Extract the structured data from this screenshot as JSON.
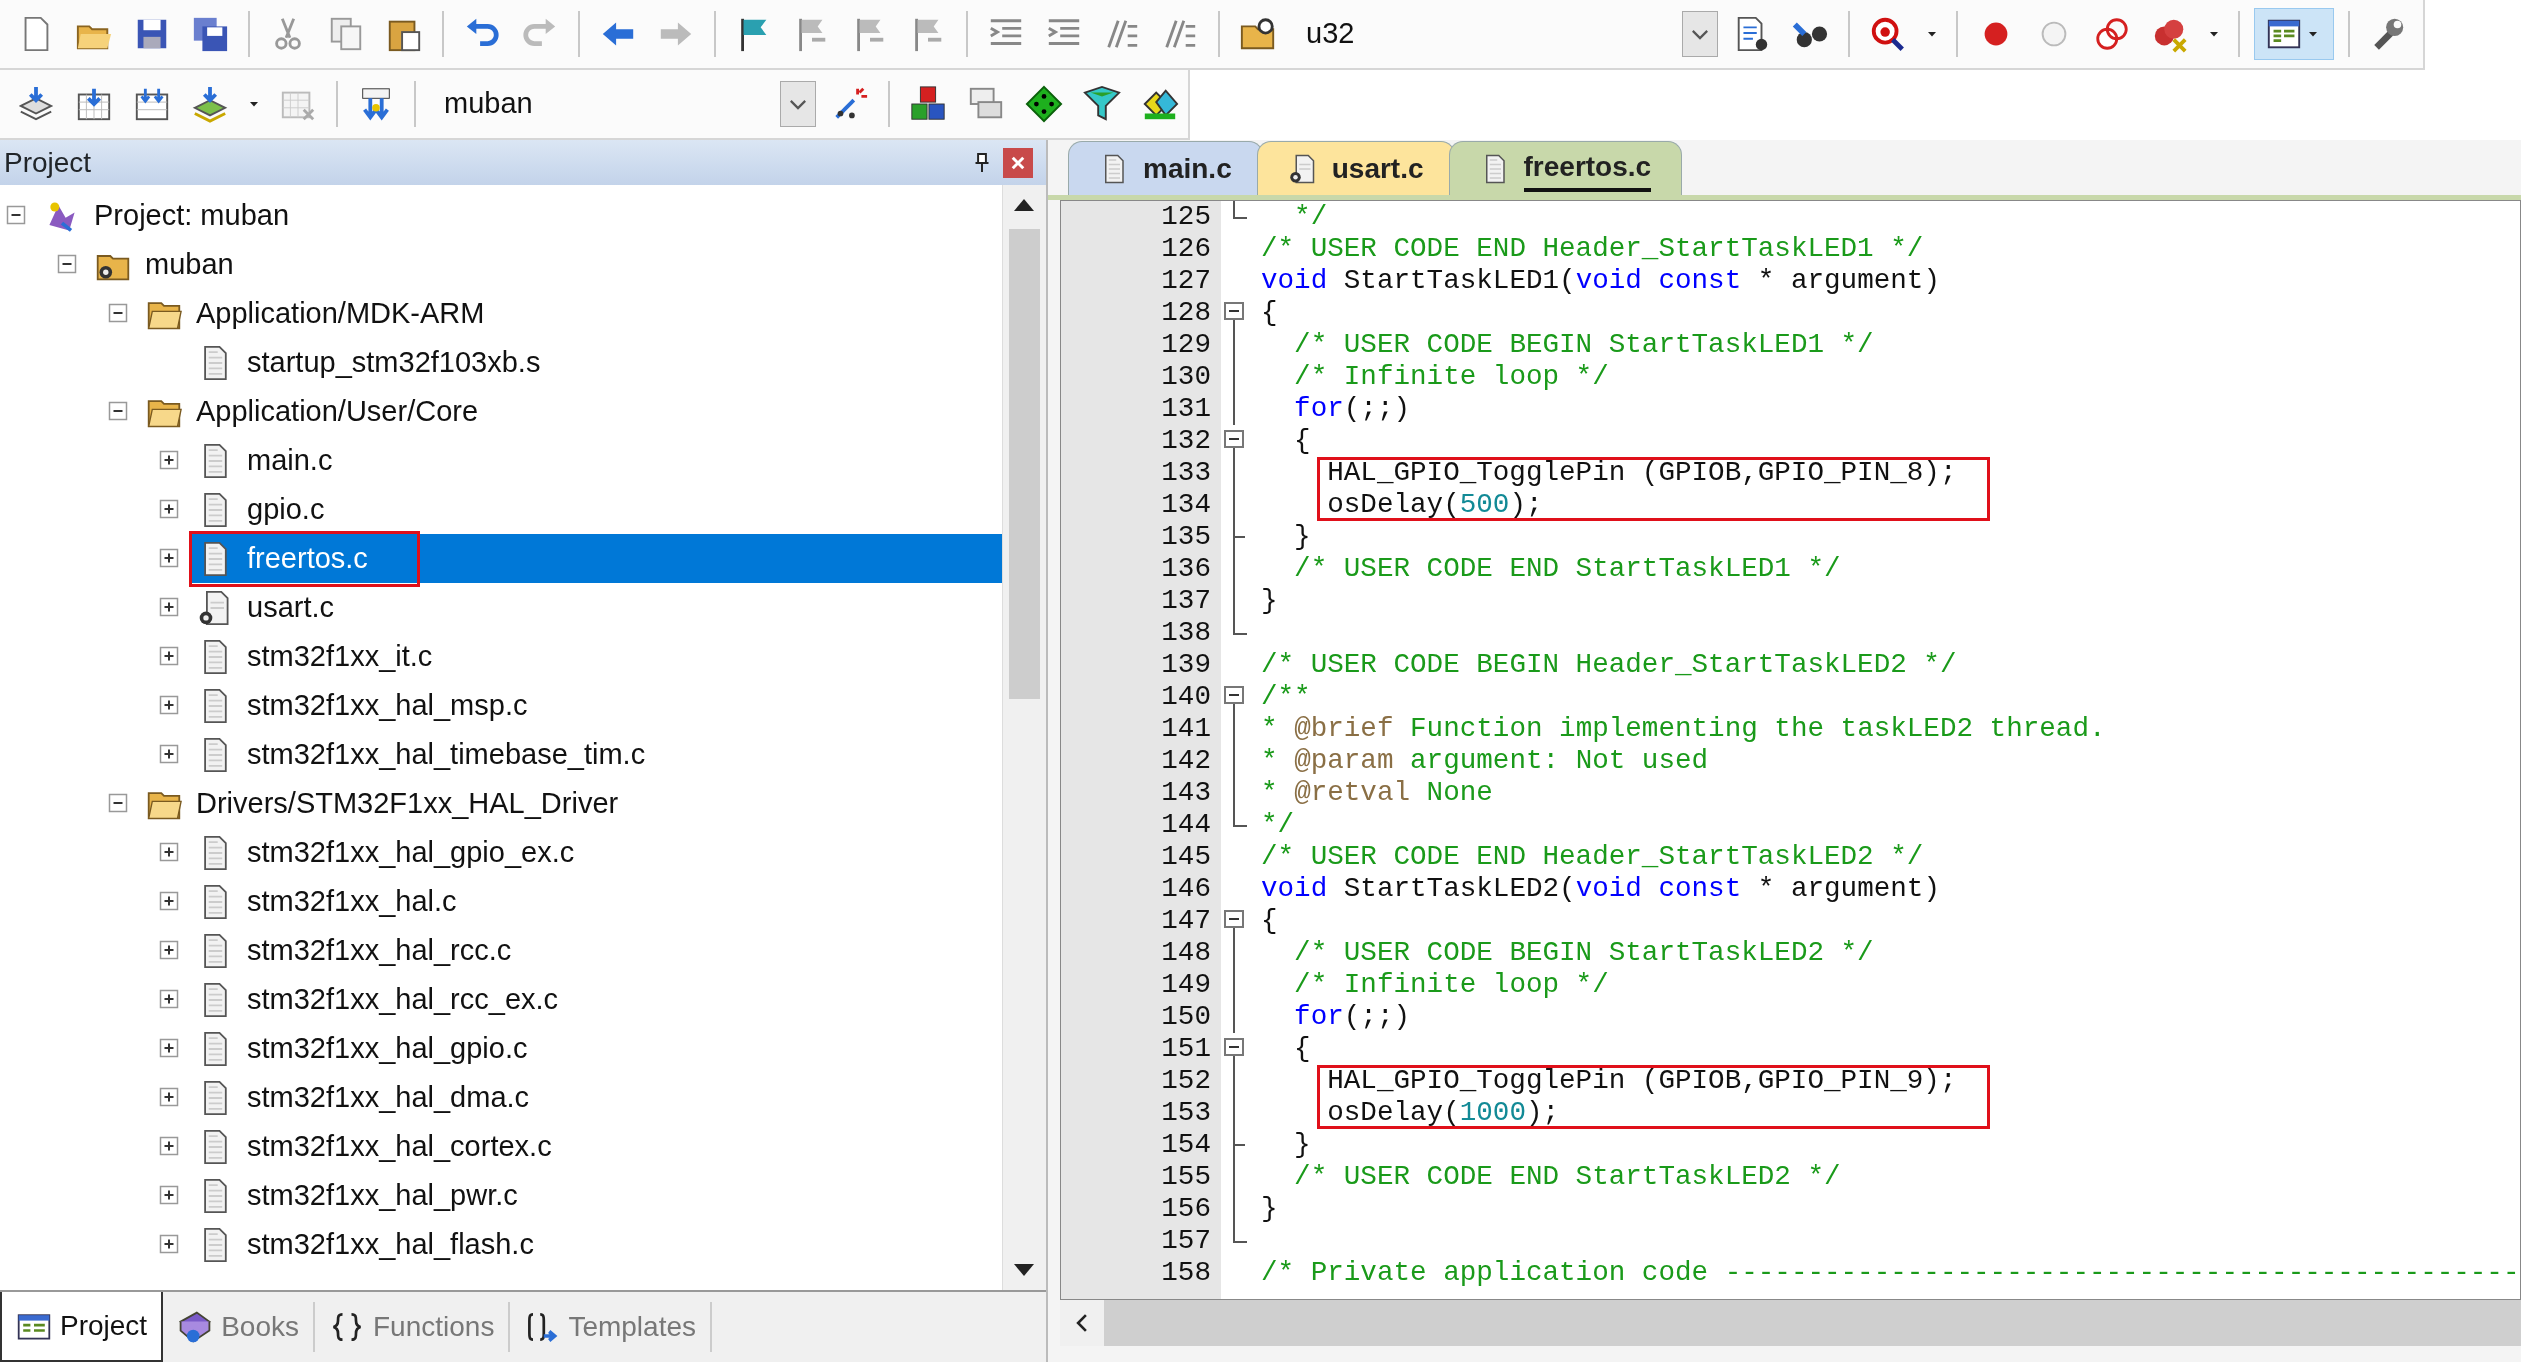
{
  "toolbar": {
    "target_combo": {
      "value": "u32"
    }
  },
  "build_toolbar": {
    "project_combo": {
      "value": "muban"
    }
  },
  "project_panel": {
    "title": "Project",
    "tree": [
      {
        "label": "Project: muban",
        "kind": "project",
        "expanded": true,
        "selected": false,
        "boxed": false,
        "children": [
          {
            "label": "muban",
            "kind": "group",
            "expanded": true,
            "selected": false,
            "boxed": false,
            "children": [
              {
                "label": "Application/MDK-ARM",
                "kind": "folder",
                "expanded": true,
                "selected": false,
                "boxed": false,
                "children": [
                  {
                    "label": "startup_stm32f103xb.s",
                    "kind": "file",
                    "selected": false,
                    "boxed": false
                  }
                ]
              },
              {
                "label": "Application/User/Core",
                "kind": "folder",
                "expanded": true,
                "selected": false,
                "boxed": false,
                "children": [
                  {
                    "label": "main.c",
                    "kind": "file",
                    "expanded": false,
                    "selected": false,
                    "boxed": false
                  },
                  {
                    "label": "gpio.c",
                    "kind": "file",
                    "expanded": false,
                    "selected": false,
                    "boxed": false
                  },
                  {
                    "label": "freertos.c",
                    "kind": "file",
                    "expanded": false,
                    "selected": true,
                    "boxed": true
                  },
                  {
                    "label": "usart.c",
                    "kind": "file_special",
                    "expanded": false,
                    "selected": false,
                    "boxed": false
                  },
                  {
                    "label": "stm32f1xx_it.c",
                    "kind": "file",
                    "expanded": false,
                    "selected": false,
                    "boxed": false
                  },
                  {
                    "label": "stm32f1xx_hal_msp.c",
                    "kind": "file",
                    "expanded": false,
                    "selected": false,
                    "boxed": false
                  },
                  {
                    "label": "stm32f1xx_hal_timebase_tim.c",
                    "kind": "file",
                    "expanded": false,
                    "selected": false,
                    "boxed": false
                  }
                ]
              },
              {
                "label": "Drivers/STM32F1xx_HAL_Driver",
                "kind": "folder",
                "expanded": true,
                "selected": false,
                "boxed": false,
                "children": [
                  {
                    "label": "stm32f1xx_hal_gpio_ex.c",
                    "kind": "file",
                    "expanded": false,
                    "selected": false,
                    "boxed": false
                  },
                  {
                    "label": "stm32f1xx_hal.c",
                    "kind": "file",
                    "expanded": false,
                    "selected": false,
                    "boxed": false
                  },
                  {
                    "label": "stm32f1xx_hal_rcc.c",
                    "kind": "file",
                    "expanded": false,
                    "selected": false,
                    "boxed": false
                  },
                  {
                    "label": "stm32f1xx_hal_rcc_ex.c",
                    "kind": "file",
                    "expanded": false,
                    "selected": false,
                    "boxed": false
                  },
                  {
                    "label": "stm32f1xx_hal_gpio.c",
                    "kind": "file",
                    "expanded": false,
                    "selected": false,
                    "boxed": false
                  },
                  {
                    "label": "stm32f1xx_hal_dma.c",
                    "kind": "file",
                    "expanded": false,
                    "selected": false,
                    "boxed": false
                  },
                  {
                    "label": "stm32f1xx_hal_cortex.c",
                    "kind": "file",
                    "expanded": false,
                    "selected": false,
                    "boxed": false
                  },
                  {
                    "label": "stm32f1xx_hal_pwr.c",
                    "kind": "file",
                    "expanded": false,
                    "selected": false,
                    "boxed": false
                  },
                  {
                    "label": "stm32f1xx_hal_flash.c",
                    "kind": "file",
                    "expanded": false,
                    "selected": false,
                    "boxed": false
                  }
                ]
              }
            ]
          }
        ]
      }
    ],
    "bottom_tabs": [
      {
        "label": "Project",
        "kind": "project",
        "selected": true
      },
      {
        "label": "Books",
        "kind": "books",
        "selected": false
      },
      {
        "label": "Functions",
        "kind": "functions",
        "selected": false
      },
      {
        "label": "Templates",
        "kind": "templates",
        "selected": false
      }
    ]
  },
  "editor": {
    "tabs": [
      {
        "label": "main.c",
        "kind": "file",
        "color": "#c9d8ef",
        "selected": false
      },
      {
        "label": "usart.c",
        "kind": "file_special",
        "color": "#fde49c",
        "selected": false
      },
      {
        "label": "freertos.c",
        "kind": "file",
        "color": "#c8d8aa",
        "selected": true
      }
    ],
    "lines": [
      {
        "number": "125",
        "kind": "fold_end",
        "boxed": false,
        "tokens": [
          {
            "kind": "comment",
            "text": "  */"
          }
        ]
      },
      {
        "number": "126",
        "kind": "plain",
        "boxed": false,
        "tokens": [
          {
            "kind": "comment",
            "text": "/* USER CODE END Header_StartTaskLED1 */"
          }
        ]
      },
      {
        "number": "127",
        "kind": "plain",
        "boxed": false,
        "tokens": [
          {
            "kind": "keyword",
            "text": "void"
          },
          {
            "kind": "plain",
            "text": " StartTaskLED1("
          },
          {
            "kind": "keyword",
            "text": "void const"
          },
          {
            "kind": "plain",
            "text": " * argument)"
          }
        ]
      },
      {
        "number": "128",
        "kind": "fold_open",
        "boxed": false,
        "tokens": [
          {
            "kind": "plain",
            "text": "{"
          }
        ]
      },
      {
        "number": "129",
        "kind": "fold_line",
        "boxed": false,
        "tokens": [
          {
            "kind": "comment",
            "text": "  /* USER CODE BEGIN StartTaskLED1 */"
          }
        ]
      },
      {
        "number": "130",
        "kind": "fold_line",
        "boxed": false,
        "tokens": [
          {
            "kind": "comment",
            "text": "  /* Infinite loop */"
          }
        ]
      },
      {
        "number": "131",
        "kind": "fold_line",
        "boxed": false,
        "tokens": [
          {
            "kind": "keyword",
            "text": "  for"
          },
          {
            "kind": "plain",
            "text": "(;;)"
          }
        ]
      },
      {
        "number": "132",
        "kind": "fold_open",
        "boxed": false,
        "tokens": [
          {
            "kind": "plain",
            "text": "  {"
          }
        ]
      },
      {
        "number": "133",
        "kind": "fold_line",
        "boxed": true,
        "tokens": [
          {
            "kind": "plain",
            "text": "    HAL_GPIO_TogglePin (GPIOB,GPIO_PIN_8);"
          }
        ]
      },
      {
        "number": "134",
        "kind": "fold_line",
        "boxed": true,
        "tokens": [
          {
            "kind": "plain",
            "text": "    osDelay("
          },
          {
            "kind": "number",
            "text": "500"
          },
          {
            "kind": "plain",
            "text": ");"
          }
        ]
      },
      {
        "number": "135",
        "kind": "fold_inner_end",
        "boxed": false,
        "tokens": [
          {
            "kind": "plain",
            "text": "  }"
          }
        ]
      },
      {
        "number": "136",
        "kind": "fold_line",
        "boxed": false,
        "tokens": [
          {
            "kind": "comment",
            "text": "  /* USER CODE END StartTaskLED1 */"
          }
        ]
      },
      {
        "number": "137",
        "kind": "fold_line",
        "boxed": false,
        "tokens": [
          {
            "kind": "plain",
            "text": "}"
          }
        ]
      },
      {
        "number": "138",
        "kind": "fold_end",
        "boxed": false
      },
      {
        "number": "139",
        "kind": "plain",
        "boxed": false,
        "tokens": [
          {
            "kind": "comment",
            "text": "/* USER CODE BEGIN Header_StartTaskLED2 */"
          }
        ]
      },
      {
        "number": "140",
        "kind": "fold_open",
        "boxed": false,
        "tokens": [
          {
            "kind": "comment",
            "text": "/**"
          }
        ]
      },
      {
        "number": "141",
        "kind": "fold_line",
        "boxed": false,
        "tokens": [
          {
            "kind": "comment",
            "text": "* "
          },
          {
            "kind": "doctag",
            "text": "@brief"
          },
          {
            "kind": "comment",
            "text": " Function implementing the taskLED2 thread."
          }
        ]
      },
      {
        "number": "142",
        "kind": "fold_line",
        "boxed": false,
        "tokens": [
          {
            "kind": "comment",
            "text": "* "
          },
          {
            "kind": "doctag",
            "text": "@param"
          },
          {
            "kind": "comment",
            "text": " argument: Not used"
          }
        ]
      },
      {
        "number": "143",
        "kind": "fold_line",
        "boxed": false,
        "tokens": [
          {
            "kind": "comment",
            "text": "* "
          },
          {
            "kind": "doctag",
            "text": "@retval"
          },
          {
            "kind": "comment",
            "text": " None"
          }
        ]
      },
      {
        "number": "144",
        "kind": "fold_end",
        "boxed": false,
        "tokens": [
          {
            "kind": "comment",
            "text": "*/"
          }
        ]
      },
      {
        "number": "145",
        "kind": "plain",
        "boxed": false,
        "tokens": [
          {
            "kind": "comment",
            "text": "/* USER CODE END Header_StartTaskLED2 */"
          }
        ]
      },
      {
        "number": "146",
        "kind": "plain",
        "boxed": false,
        "tokens": [
          {
            "kind": "keyword",
            "text": "void"
          },
          {
            "kind": "plain",
            "text": " StartTaskLED2("
          },
          {
            "kind": "keyword",
            "text": "void const"
          },
          {
            "kind": "plain",
            "text": " * argument)"
          }
        ]
      },
      {
        "number": "147",
        "kind": "fold_open",
        "boxed": false,
        "tokens": [
          {
            "kind": "plain",
            "text": "{"
          }
        ]
      },
      {
        "number": "148",
        "kind": "fold_line",
        "boxed": false,
        "tokens": [
          {
            "kind": "comment",
            "text": "  /* USER CODE BEGIN StartTaskLED2 */"
          }
        ]
      },
      {
        "number": "149",
        "kind": "fold_line",
        "boxed": false,
        "tokens": [
          {
            "kind": "comment",
            "text": "  /* Infinite loop */"
          }
        ]
      },
      {
        "number": "150",
        "kind": "fold_line",
        "boxed": false,
        "tokens": [
          {
            "kind": "keyword",
            "text": "  for"
          },
          {
            "kind": "plain",
            "text": "(;;)"
          }
        ]
      },
      {
        "number": "151",
        "kind": "fold_open",
        "boxed": false,
        "tokens": [
          {
            "kind": "plain",
            "text": "  {"
          }
        ]
      },
      {
        "number": "152",
        "kind": "fold_line",
        "boxed": true,
        "tokens": [
          {
            "kind": "plain",
            "text": "    HAL_GPIO_TogglePin (GPIOB,GPIO_PIN_9);"
          }
        ]
      },
      {
        "number": "153",
        "kind": "fold_line",
        "boxed": true,
        "tokens": [
          {
            "kind": "plain",
            "text": "    osDelay("
          },
          {
            "kind": "number",
            "text": "1000"
          },
          {
            "kind": "plain",
            "text": ");"
          }
        ]
      },
      {
        "number": "154",
        "kind": "fold_inner_end",
        "boxed": false,
        "tokens": [
          {
            "kind": "plain",
            "text": "  }"
          }
        ]
      },
      {
        "number": "155",
        "kind": "fold_line",
        "boxed": false,
        "tokens": [
          {
            "kind": "comment",
            "text": "  /* USER CODE END StartTaskLED2 */"
          }
        ]
      },
      {
        "number": "156",
        "kind": "fold_line",
        "boxed": false,
        "tokens": [
          {
            "kind": "plain",
            "text": "}"
          }
        ]
      },
      {
        "number": "157",
        "kind": "fold_end",
        "boxed": false
      },
      {
        "number": "158",
        "kind": "plain",
        "boxed": false,
        "tokens": [
          {
            "kind": "comment",
            "text": "/* Private application code ------------------------------------------------"
          }
        ]
      }
    ]
  }
}
